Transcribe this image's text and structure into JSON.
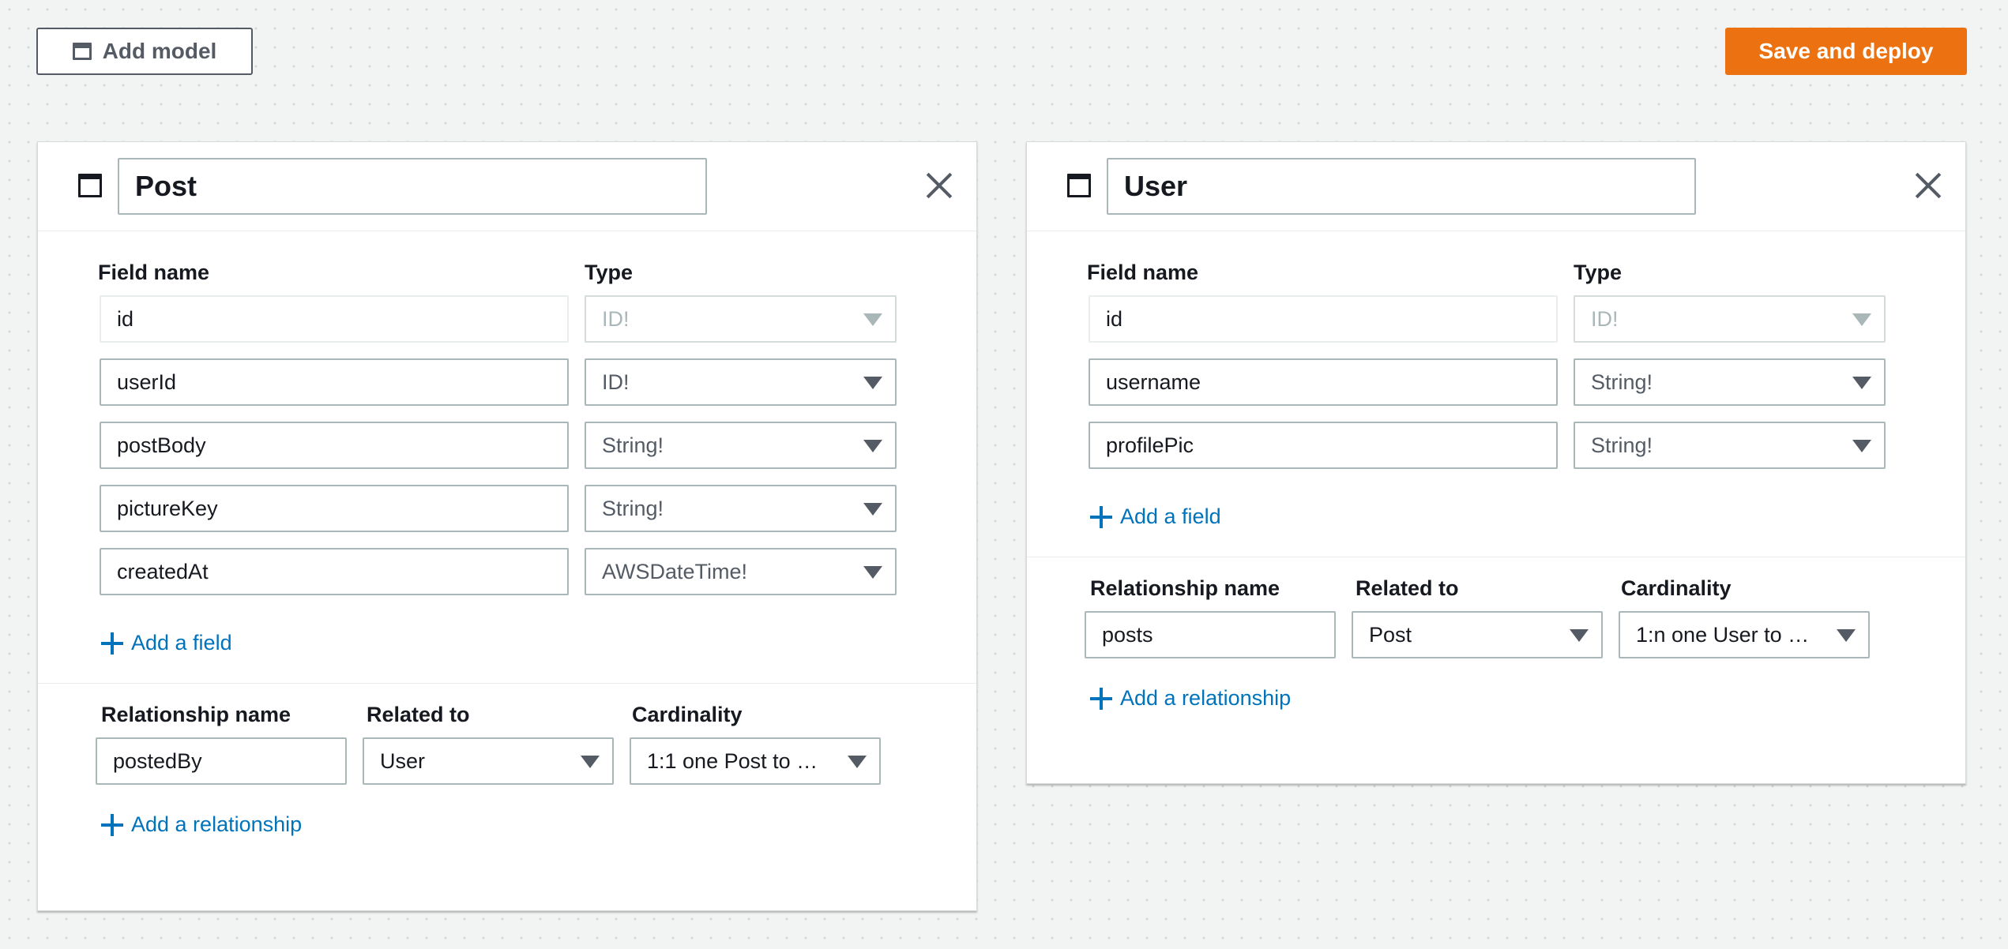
{
  "toolbar": {
    "add_model_label": "Add model",
    "save_label": "Save and deploy",
    "save_color": "#ec7211"
  },
  "labels": {
    "field_name": "Field name",
    "type": "Type",
    "relationship_name": "Relationship name",
    "related_to": "Related to",
    "cardinality": "Cardinality",
    "add_field": "Add a field",
    "add_relationship": "Add a relationship"
  },
  "post": {
    "name": "Post",
    "fields": [
      {
        "name": "id",
        "type": "ID!"
      },
      {
        "name": "userId",
        "type": "ID!"
      },
      {
        "name": "postBody",
        "type": "String!"
      },
      {
        "name": "pictureKey",
        "type": "String!"
      },
      {
        "name": "createdAt",
        "type": "AWSDateTime!"
      }
    ],
    "relationship": {
      "name": "postedBy",
      "related_to": "User",
      "cardinality": "1:1 one Post to …"
    }
  },
  "user": {
    "name": "User",
    "fields": [
      {
        "name": "id",
        "type": "ID!"
      },
      {
        "name": "username",
        "type": "String!"
      },
      {
        "name": "profilePic",
        "type": "String!"
      }
    ],
    "relationship": {
      "name": "posts",
      "related_to": "Post",
      "cardinality": "1:n one User to …"
    }
  }
}
